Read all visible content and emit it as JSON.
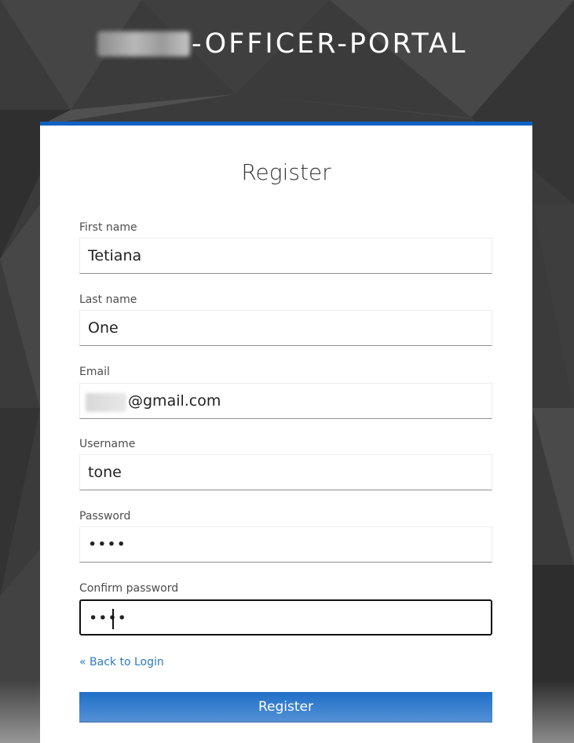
{
  "brand": {
    "title_suffix": "-OFFICER-PORTAL"
  },
  "form": {
    "title": "Register",
    "fields": [
      {
        "label": "First name",
        "value": "Tetiana"
      },
      {
        "label": "Last name",
        "value": "One"
      },
      {
        "label": "Email",
        "value": "@gmail.com"
      },
      {
        "label": "Username",
        "value": "tone"
      },
      {
        "label": "Password",
        "value": "••••"
      },
      {
        "label": "Confirm password",
        "value": "••••"
      }
    ],
    "back_link": "« Back to Login",
    "submit_label": "Register"
  },
  "colors": {
    "accent": "#0b62c4",
    "link": "#2d7ac4",
    "background": "#3a3a3a"
  }
}
